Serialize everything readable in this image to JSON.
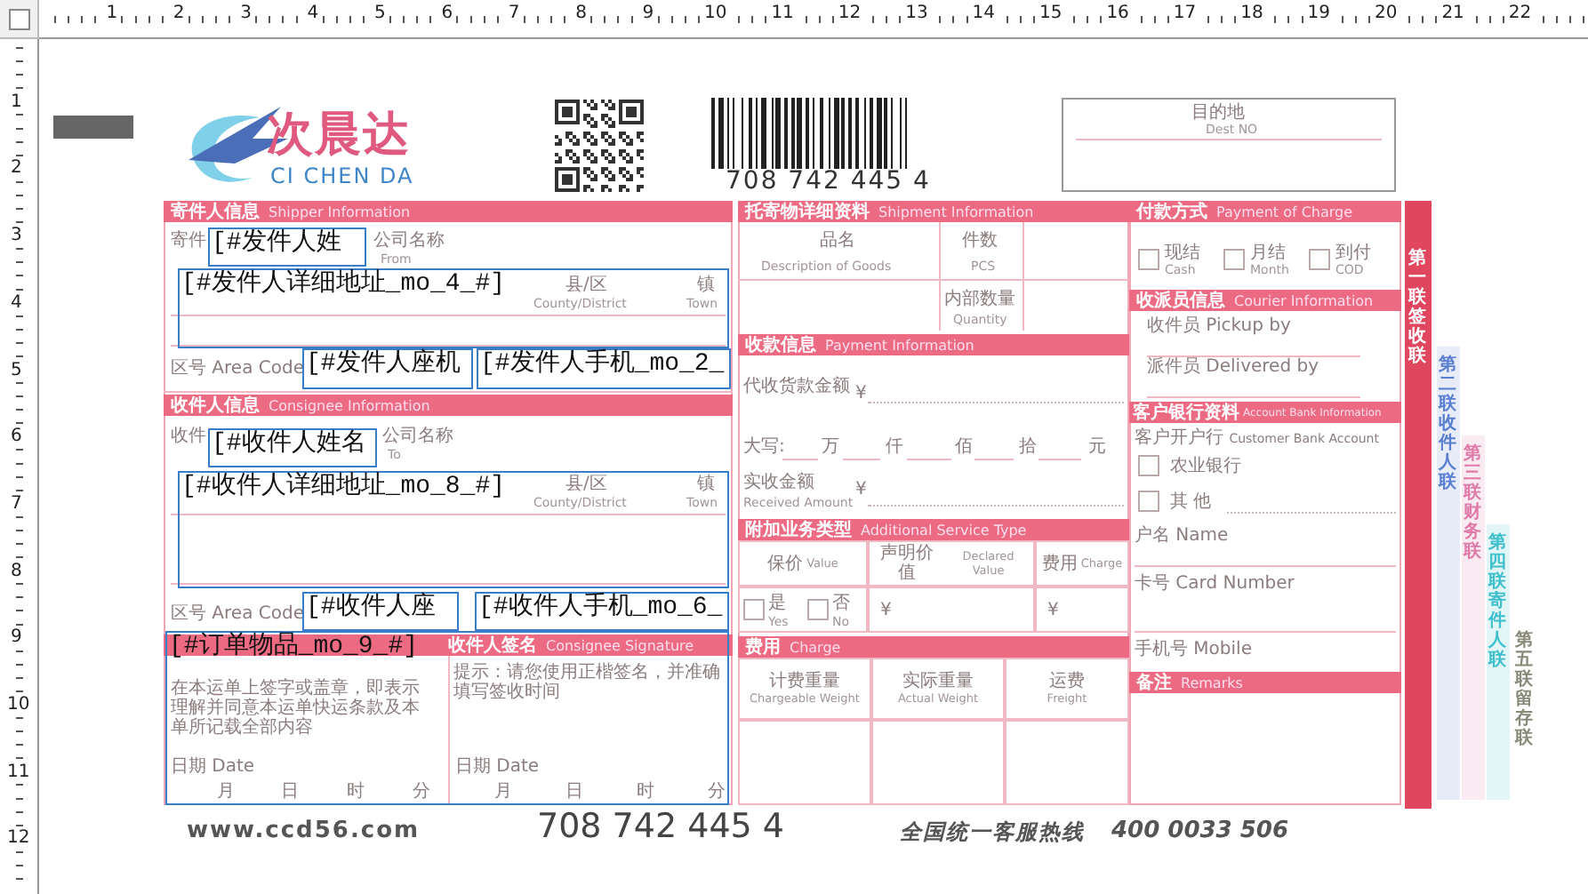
{
  "rulers": {
    "horizontal": [
      "1",
      "2",
      "3",
      "4",
      "5",
      "6",
      "7",
      "8",
      "9",
      "10",
      "11",
      "12",
      "13",
      "14",
      "15",
      "16",
      "17",
      "18",
      "19",
      "20",
      "21",
      "22"
    ],
    "vertical": [
      "1",
      "2",
      "3",
      "4",
      "5",
      "6",
      "7",
      "8",
      "9",
      "10",
      "11",
      "12"
    ]
  },
  "waybill": {
    "logo": {
      "name_cn": "次晨达",
      "name_en": "CI CHEN DA"
    },
    "barcode_number": "708 742 445 4",
    "destination": {
      "label": "目的地",
      "label_en": "Dest NO"
    },
    "shipper": {
      "title": "寄件人信息",
      "title_en": "Shipper Information",
      "labels": [
        "寄件",
        "公司名称",
        "From",
        "县/区",
        "County/District",
        "镇",
        "Town",
        "区号 Area Code"
      ]
    },
    "consignee": {
      "title": "收件人信息",
      "title_en": "Consignee Information",
      "labels": [
        "收件",
        "公司名称",
        "To",
        "县/区",
        "County/District",
        "镇",
        "Town",
        "区号 Area Code"
      ]
    },
    "signature": {
      "title": "收件人签名",
      "title_en": "Consignee Signature",
      "terms": "在本运单上签字或盖章，即表示理解并同意本运单快运条款及本单所记载全部内容",
      "hint": "提示：请您使用正楷签名，并准确填写签收时间",
      "date_labels": [
        "日期 Date",
        "日期 Date"
      ],
      "time_units": [
        "月",
        "日",
        "时",
        "分",
        "月",
        "日",
        "时",
        "分"
      ]
    },
    "shipment": {
      "title": "托寄物详细资料",
      "title_en": "Shipment Information",
      "labels": [
        "品名",
        "Description of Goods",
        "件数",
        "PCS",
        "内部数量",
        "Quantity"
      ]
    },
    "payment": {
      "title": "收款信息",
      "title_en": "Payment Information",
      "labels": [
        "代收货款金额",
        "¥",
        "大写:",
        "万",
        "仟",
        "佰",
        "拾",
        "元",
        "实收金额",
        "Received Amount",
        "¥"
      ]
    },
    "service": {
      "title": "附加业务类型",
      "title_en": "Additional Service Type",
      "columns": [
        {
          "cn": "保价",
          "en": "Value"
        },
        {
          "cn": "声明价值",
          "en": "Declared Value"
        },
        {
          "cn": "费用",
          "en": "Charge"
        }
      ],
      "options": [
        {
          "label": "是",
          "label_en": "Yes",
          "checked": false
        },
        {
          "label": "否",
          "label_en": "No",
          "checked": false
        }
      ],
      "currency": [
        "¥",
        "¥"
      ]
    },
    "charge": {
      "title": "费用",
      "title_en": "Charge",
      "columns": [
        {
          "cn": "计费重量",
          "en": "Chargeable Weight"
        },
        {
          "cn": "实际重量",
          "en": "Actual Weight"
        },
        {
          "cn": "运费",
          "en": "Freight"
        }
      ]
    },
    "payment_method": {
      "title": "付款方式",
      "title_en": "Payment of Charge",
      "options": [
        {
          "label": "现结",
          "label_en": "Cash",
          "checked": false
        },
        {
          "label": "月结",
          "label_en": "Month",
          "checked": false
        },
        {
          "label": "到付",
          "label_en": "COD",
          "checked": false
        }
      ]
    },
    "courier": {
      "title": "收派员信息",
      "title_en": "Courier Information",
      "labels": [
        "收件员 Pickup by",
        "派件员 Delivered by"
      ]
    },
    "bank": {
      "title": "客户银行资料",
      "title_en": "Account Bank Information",
      "account_label": "客户开户行 Customer Bank Account",
      "options": [
        {
          "label": "农业银行",
          "checked": false
        },
        {
          "label": "其 他",
          "checked": false
        }
      ],
      "labels": [
        "户名 Name",
        "卡号 Card Number",
        "手机号 Mobile"
      ]
    },
    "remarks": {
      "title": "备注",
      "title_en": "Remarks"
    },
    "copies": [
      {
        "text": "第一联签收联",
        "kind": "bar",
        "color": "#e0475e"
      },
      {
        "text": "第二联收件人联",
        "kind": "strip",
        "color": "#5b7fd0"
      },
      {
        "text": "第三联财务联",
        "kind": "strip",
        "color": "#e07aa8"
      },
      {
        "text": "第四联寄件人联",
        "kind": "strip",
        "color": "#3fc0cc"
      },
      {
        "text": "第五联留存联",
        "kind": "plain",
        "color": "#8a8a7a"
      }
    ],
    "footer": {
      "website": "www.ccd56.com",
      "tracking_number": "708 742 445 4",
      "hotline_label": "全国统一客服热线",
      "hotline_number": "400 0033 506"
    }
  },
  "template_fields": [
    {
      "text": "[#发件人姓"
    },
    {
      "text": "[#发件人详细地址_mo_4_#]"
    },
    {
      "text": "[#发件人座机"
    },
    {
      "text": "[#发件人手机_mo_2_"
    },
    {
      "text": "[#收件人姓名"
    },
    {
      "text": "[#收件人详细地址_mo_8_#]"
    },
    {
      "text": "[#收件人座"
    },
    {
      "text": "[#收件人手机_mo_6_"
    },
    {
      "text": "[#订单物品_mo_9_#]"
    }
  ]
}
